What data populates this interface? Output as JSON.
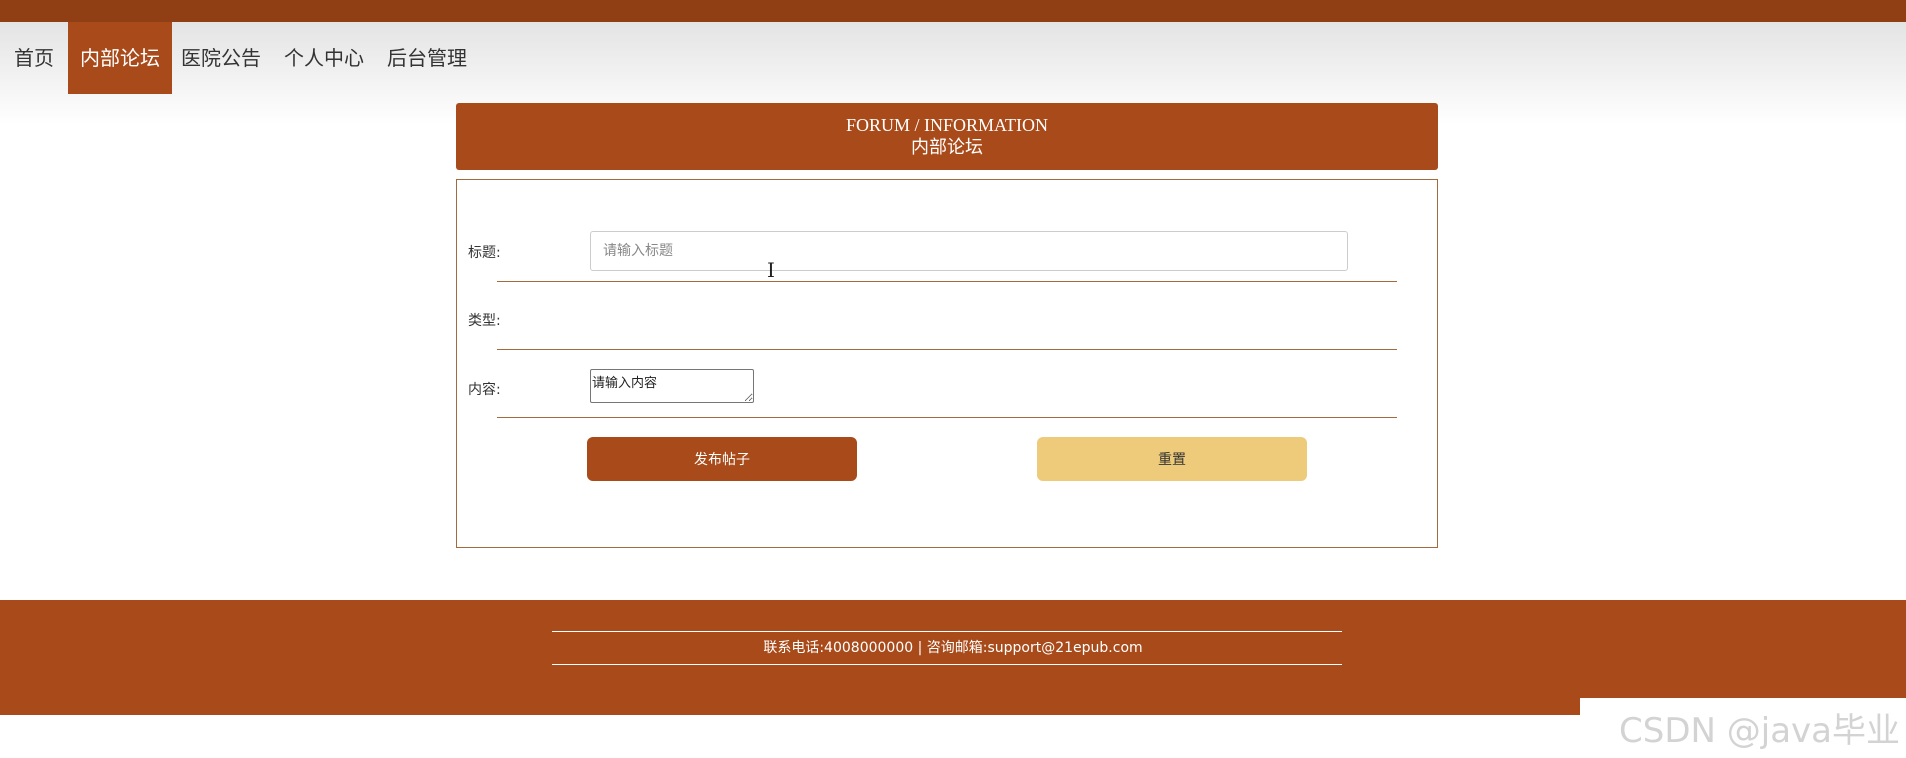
{
  "nav": {
    "items": [
      {
        "label": "首页"
      },
      {
        "label": "内部论坛"
      },
      {
        "label": "医院公告"
      },
      {
        "label": "个人中心"
      },
      {
        "label": "后台管理"
      }
    ],
    "active_index": 1
  },
  "banner": {
    "title_en": "FORUM / INFORMATION",
    "title_cn": "内部论坛"
  },
  "form": {
    "title_label": "标题:",
    "title_placeholder": "请输入标题",
    "title_value": "",
    "type_label": "类型:",
    "content_label": "内容:",
    "content_placeholder": "请输入内容",
    "submit_label": "发布帖子",
    "reset_label": "重置"
  },
  "footer": {
    "contact": "联系电话:4008000000 | 咨询邮箱:support@21epub.com"
  },
  "watermark": "CSDN @java毕业",
  "colors": {
    "top_bar": "#8f3f13",
    "accent": "#a84a19",
    "reset_button": "#edcb7a",
    "divider": "#a36a3e"
  },
  "icons": {
    "cursor": "i-beam-cursor"
  }
}
